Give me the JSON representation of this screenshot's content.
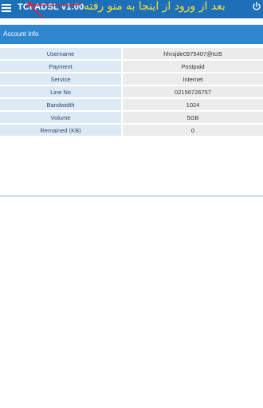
{
  "topbar": {
    "title": "TCI ADSL v1.00",
    "annotation_text": "بعد از ورود از اینجا به منو رفته",
    "menu_icon": "hamburger-menu-icon",
    "power_icon": "power-icon"
  },
  "section": {
    "title": "Account Info"
  },
  "account": {
    "rows": [
      {
        "label": "Username",
        "value": "hhrsjde0975407@tct5"
      },
      {
        "label": "Payment",
        "value": "Postpaid"
      },
      {
        "label": "Service",
        "value": "Internet"
      },
      {
        "label": "Line No",
        "value": "02156726757"
      },
      {
        "label": "Bandwidth",
        "value": "1024"
      },
      {
        "label": "Volume",
        "value": "5GB"
      },
      {
        "label": "Remained (KB)",
        "value": "0"
      }
    ]
  },
  "colors": {
    "topbar": "#1d6fb8",
    "section_header": "#2f87cf",
    "annotation_text": "#f4e03c",
    "annotation_arrow": "#e0243a"
  }
}
